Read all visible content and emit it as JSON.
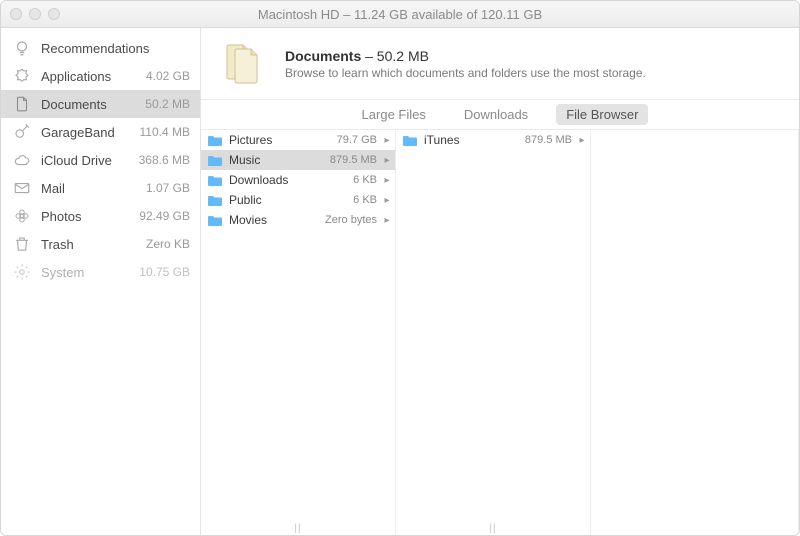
{
  "titlebar": "Macintosh HD – 11.24 GB available of 120.11 GB",
  "sidebar": {
    "items": [
      {
        "label": "Recommendations",
        "size": ""
      },
      {
        "label": "Applications",
        "size": "4.02 GB"
      },
      {
        "label": "Documents",
        "size": "50.2 MB"
      },
      {
        "label": "GarageBand",
        "size": "110.4 MB"
      },
      {
        "label": "iCloud Drive",
        "size": "368.6 MB"
      },
      {
        "label": "Mail",
        "size": "1.07 GB"
      },
      {
        "label": "Photos",
        "size": "92.49 GB"
      },
      {
        "label": "Trash",
        "size": "Zero KB"
      },
      {
        "label": "System",
        "size": "10.75 GB"
      }
    ]
  },
  "header": {
    "title_strong": "Documents",
    "title_rest": " – 50.2 MB",
    "subtitle": "Browse to learn which documents and folders use the most storage."
  },
  "tabs": {
    "t0": "Large Files",
    "t1": "Downloads",
    "t2": "File Browser"
  },
  "col1": [
    {
      "name": "Pictures",
      "size": "79.7 GB"
    },
    {
      "name": "Music",
      "size": "879.5 MB"
    },
    {
      "name": "Downloads",
      "size": "6 KB"
    },
    {
      "name": "Public",
      "size": "6 KB"
    },
    {
      "name": "Movies",
      "size": "Zero bytes"
    }
  ],
  "col2": [
    {
      "name": "iTunes",
      "size": "879.5 MB"
    }
  ]
}
